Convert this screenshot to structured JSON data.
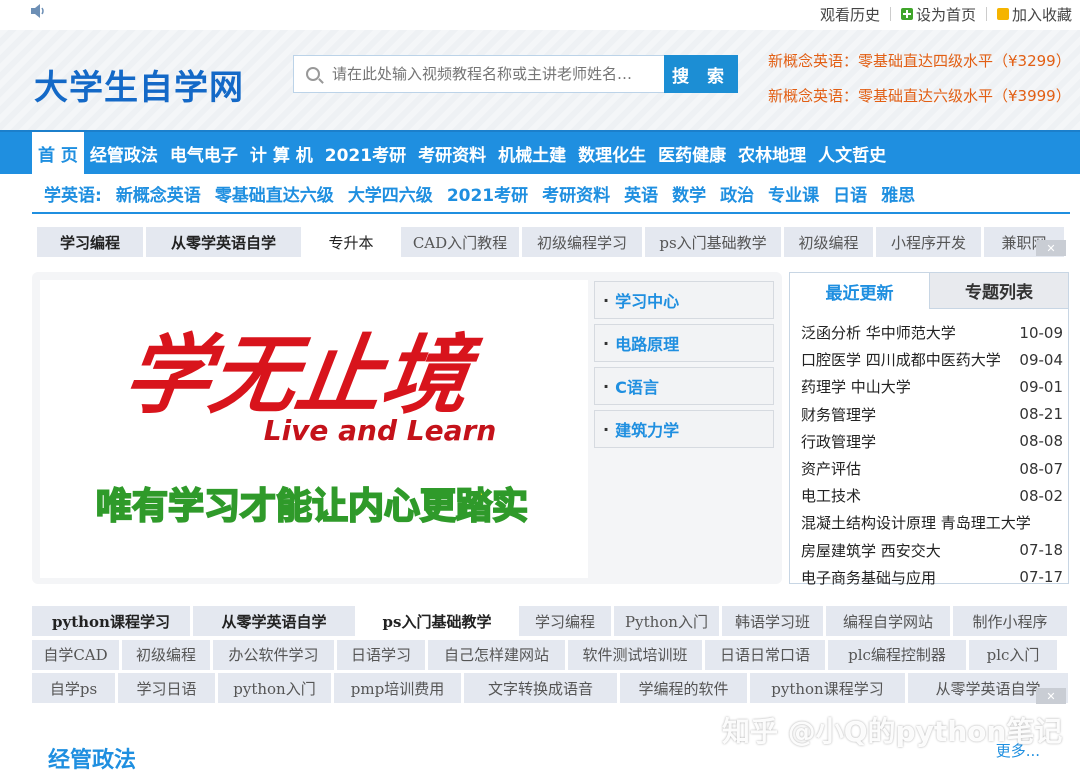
{
  "topbar": {
    "links": [
      "观看历史",
      "设为首页",
      "加入收藏"
    ]
  },
  "header": {
    "logo": "大学生自学网",
    "search_placeholder": "请在此处输入视频教程名称或主讲老师姓名…",
    "search_button": "搜 索",
    "promos": [
      "新概念英语：零基础直达四级水平（¥3299）",
      "新概念英语：零基础直达六级水平（¥3999）"
    ]
  },
  "nav_main": [
    "首 页",
    "经管政法",
    "电气电子",
    "计 算 机",
    "2021考研",
    "考研资料",
    "机械土建",
    "数理化生",
    "医药健康",
    "农林地理",
    "人文哲史"
  ],
  "nav_sub": [
    "学英语:",
    "新概念英语",
    "零基础直达六级",
    "大学四六级",
    "2021考研",
    "考研资料",
    "英语",
    "数学",
    "政治",
    "专业课",
    "日语",
    "雅思"
  ],
  "tags_top": [
    "学习编程",
    "从零学英语自学",
    "专升本",
    "CAD入门教程",
    "初级编程学习",
    "ps入门基础教学",
    "初级编程",
    "小程序开发",
    "兼职网"
  ],
  "banner": {
    "headline": "学无止境",
    "subline": "Live and Learn",
    "motto": "唯有学习才能让内心更踏实"
  },
  "side_menu": [
    "学习中心",
    "电路原理",
    "C语言",
    "建筑力学"
  ],
  "panel": {
    "tab_active": "最近更新",
    "tab_other": "专题列表",
    "items": [
      {
        "title": "泛函分析 华中师范大学",
        "date": "10-09"
      },
      {
        "title": "口腔医学 四川成都中医药大学",
        "date": "09-04"
      },
      {
        "title": "药理学 中山大学",
        "date": "09-01"
      },
      {
        "title": "财务管理学",
        "date": "08-21"
      },
      {
        "title": "行政管理学",
        "date": "08-08"
      },
      {
        "title": "资产评估",
        "date": "08-07"
      },
      {
        "title": "电工技术",
        "date": "08-02"
      },
      {
        "title": "混凝土结构设计原理 青岛理工大学",
        "date": ""
      },
      {
        "title": "房屋建筑学 西安交大",
        "date": "07-18"
      },
      {
        "title": "电子商务基础与应用",
        "date": "07-17"
      }
    ]
  },
  "tag_grid": {
    "row1": [
      "python课程学习",
      "从零学英语自学",
      "ps入门基础教学",
      "学习编程",
      "Python入门",
      "韩语学习班",
      "编程自学网站",
      "制作小程序"
    ],
    "row2": [
      "自学CAD",
      "初级编程",
      "办公软件学习",
      "日语学习",
      "自己怎样建网站",
      "软件测试培训班",
      "日语日常口语",
      "plc编程控制器",
      "plc入门"
    ],
    "row3": [
      "自学ps",
      "学习日语",
      "python入门",
      "pmp培训费用",
      "文字转换成语音",
      "学编程的软件",
      "python课程学习",
      "从零学英语自学"
    ]
  },
  "section": {
    "title": "经管政法",
    "more": "更多..."
  },
  "watermark": "知乎 @小Q的python笔记"
}
